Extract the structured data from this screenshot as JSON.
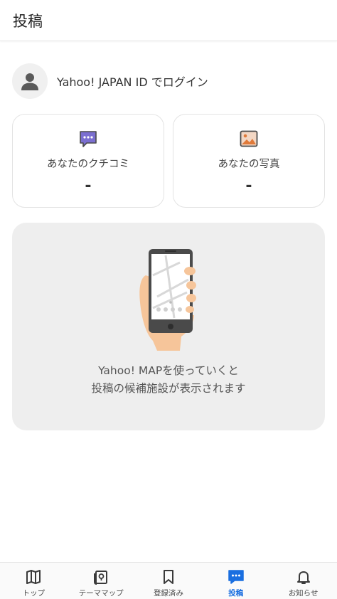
{
  "header": {
    "title": "投稿"
  },
  "login": {
    "label": "Yahoo! JAPAN ID でログイン"
  },
  "cards": [
    {
      "label": "あなたのクチコミ",
      "value": "-",
      "icon": "review-bubble-icon"
    },
    {
      "label": "あなたの写真",
      "value": "-",
      "icon": "photo-icon"
    }
  ],
  "promo": {
    "line1": "Yahoo! MAPを使っていくと",
    "line2": "投稿の候補施設が表示されます"
  },
  "tabbar": {
    "active": "投稿",
    "items": [
      {
        "label": "トップ",
        "icon": "map-book-icon"
      },
      {
        "label": "テーママップ",
        "icon": "theme-map-icon"
      },
      {
        "label": "登録済み",
        "icon": "bookmark-icon"
      },
      {
        "label": "投稿",
        "icon": "post-bubble-icon"
      },
      {
        "label": "お知らせ",
        "icon": "bell-icon"
      }
    ]
  },
  "colors": {
    "accent": "#1a6fe0",
    "review_icon": "#7b6fd0",
    "photo_icon": "#e07a3a"
  }
}
